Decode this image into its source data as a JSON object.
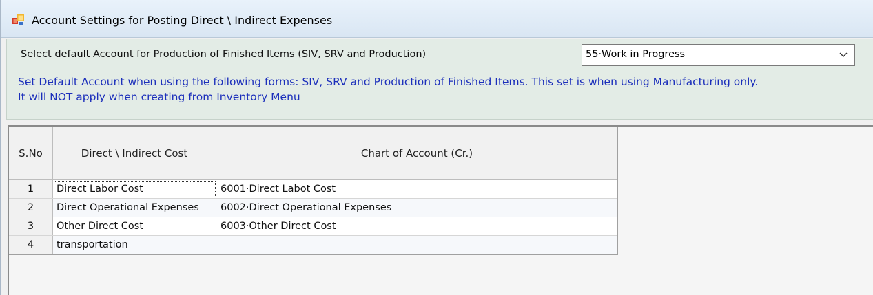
{
  "window": {
    "title": "Account Settings for Posting Direct \\ Indirect Expenses",
    "icon": "app-window-icon"
  },
  "settings": {
    "select_label": "Select default Account for Production of Finished Items (SIV, SRV and Production)",
    "account_value": "55·Work in Progress",
    "info_line_1": "Set Default Account when using the following forms: SIV, SRV and Production of Finished Items. This set is when using Manufacturing only.",
    "info_line_2": "It will NOT apply when creating from Inventory Menu",
    "info_color": "#1c2fbb"
  },
  "grid": {
    "headers": {
      "sno": "S.No",
      "cost": "Direct \\ Indirect Cost",
      "account": "Chart of Account (Cr.)"
    },
    "rows": [
      {
        "sno": "1",
        "cost": "Direct Labor Cost",
        "account": "6001·Direct Labot Cost"
      },
      {
        "sno": "2",
        "cost": "Direct Operational Expenses",
        "account": "6002·Direct Operational Expenses"
      },
      {
        "sno": "3",
        "cost": "Other Direct Cost",
        "account": "6003·Other Direct Cost"
      },
      {
        "sno": "4",
        "cost": "transportation",
        "account": ""
      }
    ]
  }
}
